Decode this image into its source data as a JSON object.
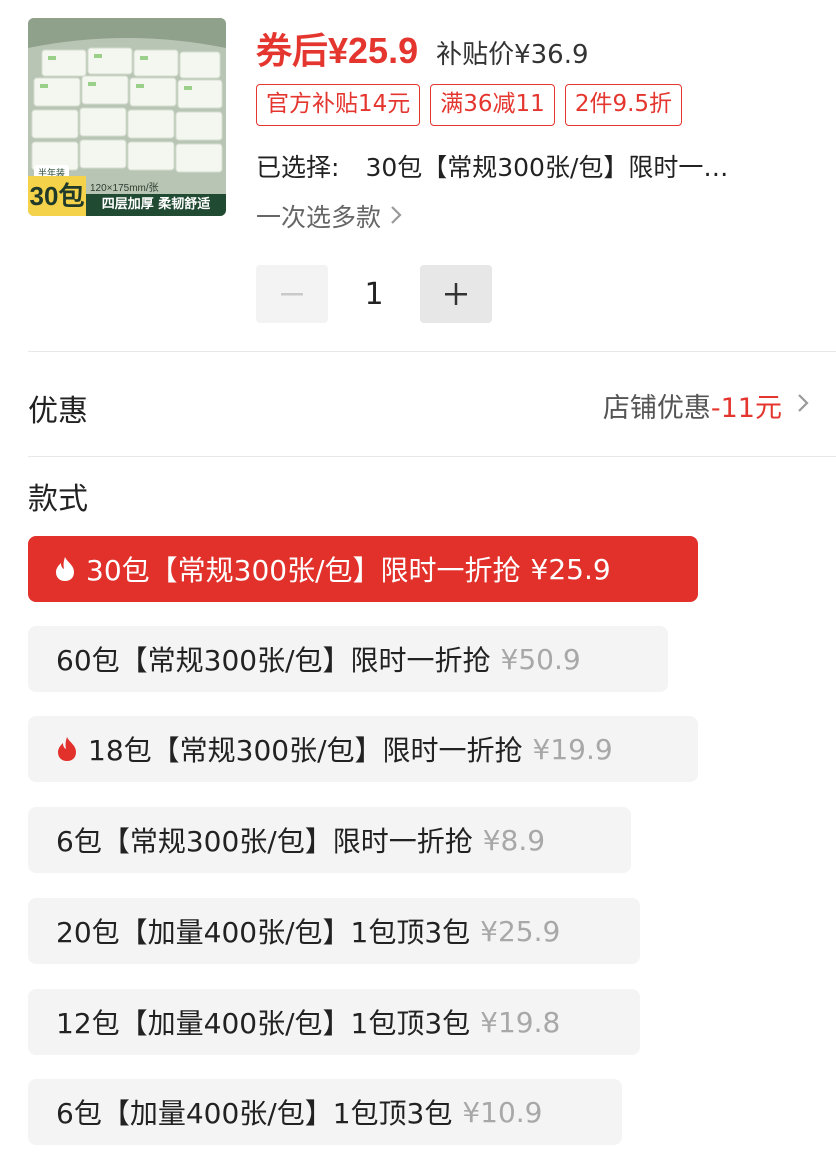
{
  "product": {
    "thumb_half_year": "半年装",
    "thumb_count": "30包",
    "thumb_size": "120×175mm/张",
    "thumb_slogan": "四层加厚 柔韧舒适"
  },
  "price": {
    "coupon_label": "券后¥25.9",
    "subsidy_label": "补贴价¥36.9"
  },
  "tags": [
    "官方补贴14元",
    "满36减11",
    "2件9.5折"
  ],
  "selection": {
    "label": "已选择:",
    "value": "30包【常规300张/包】限时一…"
  },
  "multi_select": {
    "label": "一次选多款"
  },
  "stepper": {
    "minus": "−",
    "quantity": "1",
    "plus": "+"
  },
  "discount": {
    "label": "优惠",
    "text": "店铺优惠",
    "amount": "-11元"
  },
  "style_section": {
    "label": "款式"
  },
  "variants": [
    {
      "name": "30包【常规300张/包】限时一折抢",
      "price": "¥25.9",
      "hot": true,
      "selected": true
    },
    {
      "name": "60包【常规300张/包】限时一折抢",
      "price": "¥50.9",
      "hot": false,
      "selected": false
    },
    {
      "name": "18包【常规300张/包】限时一折抢",
      "price": "¥19.9",
      "hot": true,
      "selected": false
    },
    {
      "name": "6包【常规300张/包】限时一折抢",
      "price": "¥8.9",
      "hot": false,
      "selected": false
    },
    {
      "name": "20包【加量400张/包】1包顶3包",
      "price": "¥25.9",
      "hot": false,
      "selected": false
    },
    {
      "name": "12包【加量400张/包】1包顶3包",
      "price": "¥19.8",
      "hot": false,
      "selected": false
    },
    {
      "name": "6包【加量400张/包】1包顶3包",
      "price": "¥10.9",
      "hot": false,
      "selected": false
    }
  ],
  "colors": {
    "accent": "#e4362f",
    "selected_bg": "#e2302b",
    "variant_bg": "#f4f4f4",
    "muted_price": "#a8a8a8"
  }
}
